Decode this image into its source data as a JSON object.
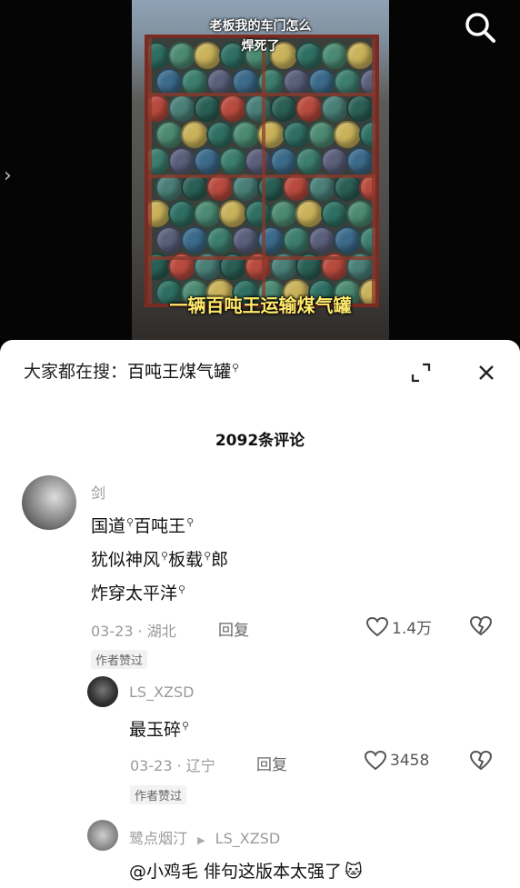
{
  "video": {
    "caption_top": "老板我的车门怎么\n焊死了",
    "caption_bottom": "一辆百吨王运输煤气罐",
    "search_icon": "search-icon",
    "nav_icon": "chevron-right-icon"
  },
  "sheet": {
    "suggest_prefix": "大家都在搜：",
    "suggest_keyword": "百吨王煤气罐",
    "expand_icon": "expand-icon",
    "close_icon": "close-icon",
    "comment_count": "2092条评论"
  },
  "comments": [
    {
      "name": "剑",
      "lines": [
        [
          {
            "t": "国道",
            "q": true
          },
          {
            "t": "百吨王",
            "q": true
          }
        ],
        [
          {
            "t": "犹似神风",
            "q": true
          },
          {
            "t": "板载",
            "q": true
          },
          {
            "t": "郎",
            "q": false
          }
        ],
        [
          {
            "t": "炸穿太平洋",
            "q": true
          }
        ]
      ],
      "date": "03-23 · 湖北",
      "reply": "回复",
      "likes": "1.4万",
      "author_badge": "作者赞过"
    },
    {
      "name": "LS_XZSD",
      "lines": [
        [
          {
            "t": "最玉碎",
            "q": true
          }
        ]
      ],
      "date": "03-23 · 辽宁",
      "reply": "回复",
      "likes": "3458",
      "author_badge": "作者赞过"
    },
    {
      "name": "鹭点烟汀",
      "reply_to": "LS_XZSD",
      "text": "@小鸡毛 俳句这版本太强了"
    }
  ],
  "colors": {
    "caption_bottom": "#ffe96b",
    "sheet_bg": "#ffffff",
    "meta_grey": "#9a9a9a"
  }
}
